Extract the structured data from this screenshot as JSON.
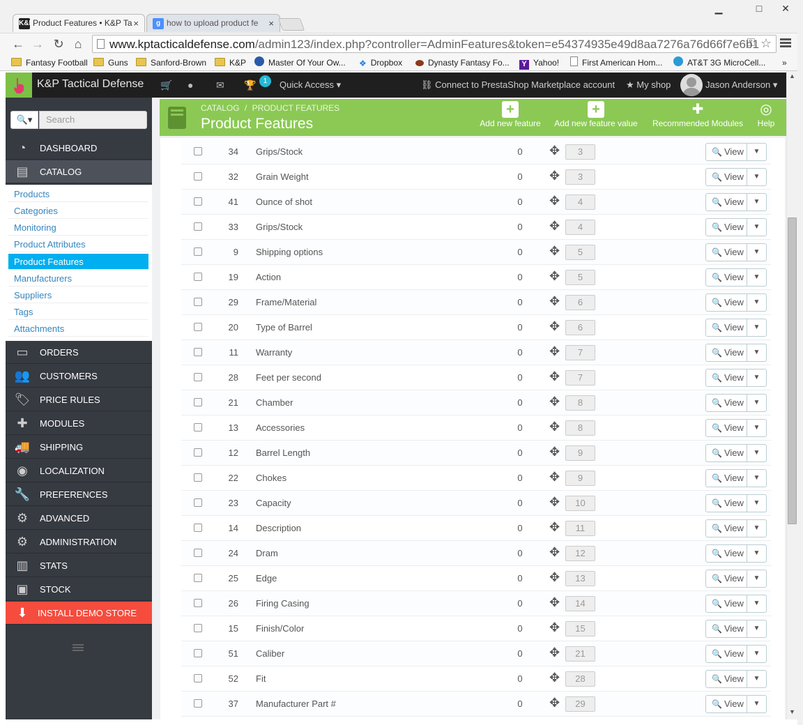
{
  "browser": {
    "tabs": [
      {
        "title": "Product Features • K&P Ta",
        "favicon": "K&P",
        "active": true
      },
      {
        "title": "how to upload product fe",
        "favicon": "g",
        "active": false
      }
    ],
    "close_glyph": "×",
    "window_controls": {
      "minimize": "▁",
      "maximize": "□",
      "close": "✕"
    },
    "url_host": "www.kptacticaldefense.com",
    "url_path": "/admin123/index.php?controller=AdminFeatures&token=e54374935e49d8aa7276a76d66f7e6b1",
    "bookmarks": [
      {
        "label": "Fantasy Football",
        "icon": "folder-icon"
      },
      {
        "label": "Guns",
        "icon": "folder-icon"
      },
      {
        "label": "Sanford-Brown",
        "icon": "folder-icon"
      },
      {
        "label": "K&P",
        "icon": "folder-icon"
      },
      {
        "label": "Master Of Your Ow...",
        "icon": "eye-icon"
      },
      {
        "label": "Dropbox",
        "icon": "dropbox-icon"
      },
      {
        "label": "Dynasty Fantasy Fo...",
        "icon": "football-icon"
      },
      {
        "label": "Yahoo!",
        "icon": "yahoo-icon"
      },
      {
        "label": "First American Hom...",
        "icon": "page-icon"
      },
      {
        "label": "AT&T 3G MicroCell...",
        "icon": "att-icon"
      }
    ],
    "bookmarks_overflow": "»"
  },
  "topnav": {
    "brand": "K&P Tactical Defense",
    "notification_count": "1",
    "quick_access": "Quick Access ▾",
    "connect": "Connect to PrestaShop Marketplace account",
    "my_shop": "My shop",
    "user": "Jason Anderson ▾"
  },
  "sidebar": {
    "search_placeholder": "Search",
    "items": [
      {
        "label": "DASHBOARD",
        "icon": "dashboard-icon"
      },
      {
        "label": "CATALOG",
        "icon": "book-icon"
      },
      {
        "label": "ORDERS",
        "icon": "credit-card-icon"
      },
      {
        "label": "CUSTOMERS",
        "icon": "users-icon"
      },
      {
        "label": "PRICE RULES",
        "icon": "tag-icon"
      },
      {
        "label": "MODULES",
        "icon": "puzzle-icon"
      },
      {
        "label": "SHIPPING",
        "icon": "truck-icon"
      },
      {
        "label": "LOCALIZATION",
        "icon": "globe-icon"
      },
      {
        "label": "PREFERENCES",
        "icon": "wrench-icon"
      },
      {
        "label": "ADVANCED PARAMETERS",
        "icon": "gears-icon"
      },
      {
        "label": "ADMINISTRATION",
        "icon": "gear-icon"
      },
      {
        "label": "STATS",
        "icon": "bar-chart-icon"
      },
      {
        "label": "STOCK",
        "icon": "archive-icon"
      },
      {
        "label": "INSTALL DEMO STORE",
        "icon": "download-icon"
      }
    ],
    "catalog_submenu": [
      {
        "label": "Products",
        "active": false
      },
      {
        "label": "Categories",
        "active": false
      },
      {
        "label": "Monitoring",
        "active": false
      },
      {
        "label": "Product Attributes",
        "active": false
      },
      {
        "label": "Product Features",
        "active": true
      },
      {
        "label": "Manufacturers",
        "active": false
      },
      {
        "label": "Suppliers",
        "active": false
      },
      {
        "label": "Tags",
        "active": false
      },
      {
        "label": "Attachments",
        "active": false
      }
    ]
  },
  "header": {
    "breadcrumb": [
      "CATALOG",
      "/",
      "PRODUCT FEATURES"
    ],
    "title": "Product Features",
    "buttons": [
      {
        "label": "Add new feature",
        "icon": "plus-icon"
      },
      {
        "label": "Add new feature value",
        "icon": "plus-icon"
      },
      {
        "label": "Recommended Modules",
        "icon": "puzzle-icon"
      },
      {
        "label": "Help",
        "icon": "lifebuoy-icon"
      }
    ]
  },
  "table": {
    "view_label": "View",
    "rows": [
      {
        "id": "34",
        "name": "Grips/Stock",
        "values": "0",
        "position": "3"
      },
      {
        "id": "32",
        "name": "Grain Weight",
        "values": "0",
        "position": "3"
      },
      {
        "id": "41",
        "name": "Ounce of shot",
        "values": "0",
        "position": "4"
      },
      {
        "id": "33",
        "name": "Grips/Stock",
        "values": "0",
        "position": "4"
      },
      {
        "id": "9",
        "name": "Shipping options",
        "values": "0",
        "position": "5"
      },
      {
        "id": "19",
        "name": "Action",
        "values": "0",
        "position": "5"
      },
      {
        "id": "29",
        "name": "Frame/Material",
        "values": "0",
        "position": "6"
      },
      {
        "id": "20",
        "name": "Type of Barrel",
        "values": "0",
        "position": "6"
      },
      {
        "id": "11",
        "name": "Warranty",
        "values": "0",
        "position": "7"
      },
      {
        "id": "28",
        "name": "Feet per second",
        "values": "0",
        "position": "7"
      },
      {
        "id": "21",
        "name": "Chamber",
        "values": "0",
        "position": "8"
      },
      {
        "id": "13",
        "name": "Accessories",
        "values": "0",
        "position": "8"
      },
      {
        "id": "12",
        "name": "Barrel Length",
        "values": "0",
        "position": "9"
      },
      {
        "id": "22",
        "name": "Chokes",
        "values": "0",
        "position": "9"
      },
      {
        "id": "23",
        "name": "Capacity",
        "values": "0",
        "position": "10"
      },
      {
        "id": "14",
        "name": "Description",
        "values": "0",
        "position": "11"
      },
      {
        "id": "24",
        "name": "Dram",
        "values": "0",
        "position": "12"
      },
      {
        "id": "25",
        "name": "Edge",
        "values": "0",
        "position": "13"
      },
      {
        "id": "26",
        "name": "Firing Casing",
        "values": "0",
        "position": "14"
      },
      {
        "id": "15",
        "name": "Finish/Color",
        "values": "0",
        "position": "15"
      },
      {
        "id": "51",
        "name": "Caliber",
        "values": "0",
        "position": "21"
      },
      {
        "id": "52",
        "name": "Fit",
        "values": "0",
        "position": "28"
      },
      {
        "id": "37",
        "name": "Manufacturer Part #",
        "values": "0",
        "position": "29"
      }
    ]
  },
  "colors": {
    "header_green": "#8bc954",
    "sidebar_bg": "#363a41",
    "active_submenu": "#00aff0",
    "demo_store_red": "#f54c3e",
    "topnav_bg": "#1f1f1f"
  }
}
